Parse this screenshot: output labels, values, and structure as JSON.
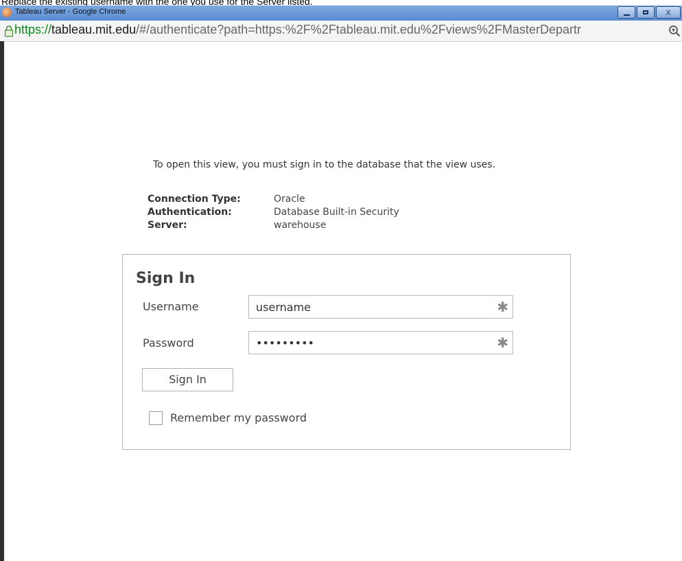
{
  "caption": "Replace the existing username with the one you use for the Server listed.",
  "window": {
    "title": "Tableau Server - Google Chrome",
    "buttons": {
      "minimize": "",
      "maximize": "",
      "close": "X"
    }
  },
  "address_bar": {
    "scheme": "https://",
    "host": "tableau.mit.edu",
    "path": "/#/authenticate?path=https:%2F%2Ftableau.mit.edu%2Fviews%2FMasterDepartr",
    "icons": {
      "lock": "lock-icon",
      "zoom": "zoom-icon"
    }
  },
  "page": {
    "intro": "To open this view, you must sign in to the database that the view uses.",
    "details": [
      {
        "label": "Connection Type:",
        "value": "Oracle"
      },
      {
        "label": "Authentication:",
        "value": "Database Built-in Security"
      },
      {
        "label": "Server:",
        "value": "warehouse"
      }
    ]
  },
  "sign_in": {
    "title": "Sign In",
    "username_label": "Username",
    "username_value": "username",
    "password_label": "Password",
    "password_value": "•••••••••",
    "required_marker": "✱",
    "button_label": "Sign In",
    "remember_label": "Remember my password",
    "remember_checked": false
  },
  "colors": {
    "url_scheme": "#0a8a18",
    "titlebar": "#6b9ad6"
  }
}
